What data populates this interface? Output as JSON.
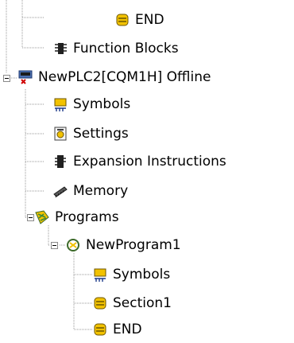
{
  "tree": {
    "items": [
      {
        "label": "END",
        "icon": "end-section-icon"
      },
      {
        "label": "Function Blocks",
        "icon": "function-blocks-icon"
      },
      {
        "label": "NewPLC2[CQM1H] Offline",
        "icon": "plc-offline-icon",
        "expanded": true
      },
      {
        "label": "Symbols",
        "icon": "symbols-icon"
      },
      {
        "label": "Settings",
        "icon": "settings-icon"
      },
      {
        "label": "Expansion Instructions",
        "icon": "expansion-instructions-icon"
      },
      {
        "label": "Memory",
        "icon": "memory-icon"
      },
      {
        "label": "Programs",
        "icon": "programs-icon",
        "expanded": true
      },
      {
        "label": "NewProgram1",
        "icon": "program-icon",
        "expanded": true
      },
      {
        "label": "Symbols",
        "icon": "symbols-icon"
      },
      {
        "label": "Section1",
        "icon": "section-icon"
      },
      {
        "label": "END",
        "icon": "end-section-icon"
      }
    ]
  },
  "colors": {
    "guide": "#9a9a9a",
    "accent_yellow": "#f2c200",
    "accent_red": "#d00000",
    "accent_green": "#3c8a3c"
  }
}
